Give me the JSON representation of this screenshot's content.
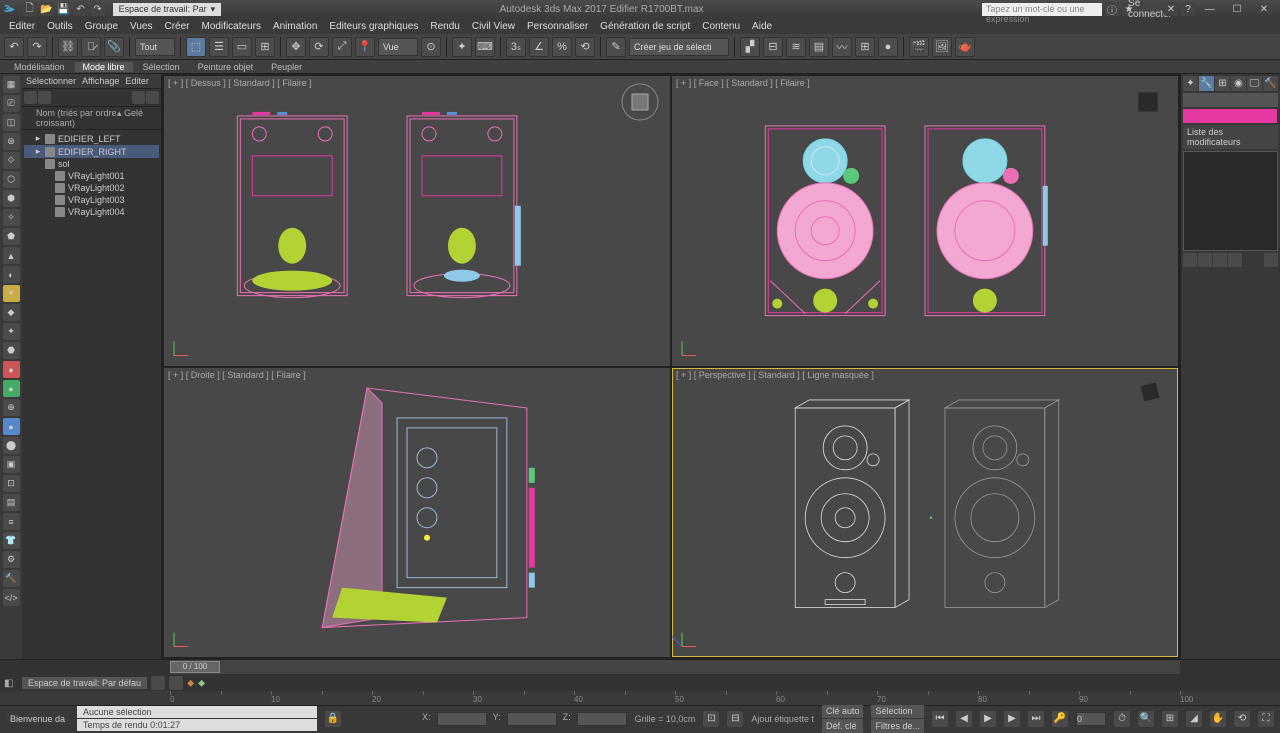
{
  "app": {
    "title": "Autodesk 3ds Max 2017    Edifier R1700BT.max",
    "workspace_tab": "Espace de travail: Par",
    "search_placeholder": "Tapez un mot-clé ou une expression",
    "signin": "Se connecter"
  },
  "menu": [
    "Editer",
    "Outils",
    "Groupe",
    "Vues",
    "Créer",
    "Modificateurs",
    "Animation",
    "Editeurs graphiques",
    "Rendu",
    "Civil View",
    "Personnaliser",
    "Génération de script",
    "Contenu",
    "Aide"
  ],
  "toolbar": {
    "dd_tout": "Tout",
    "dd_vue": "Vue",
    "create_sel": "Créer jeu de sélecti"
  },
  "ribbon": {
    "items": [
      "Modélisation",
      "Mode libre",
      "Sélection",
      "Peinture objet",
      "Peupler"
    ],
    "active": 1
  },
  "scene": {
    "tabs": [
      "Sélectionner",
      "Affichage",
      "Editer"
    ],
    "col1": "Nom (triés par ordre croissant)",
    "col2": "Gelé",
    "items": [
      {
        "exp": "▸",
        "name": "EDIFIER_LEFT",
        "sel": false,
        "indent": 1
      },
      {
        "exp": "▸",
        "name": "EDIFIER_RIGHT",
        "sel": true,
        "indent": 1
      },
      {
        "exp": "",
        "name": "sol",
        "sel": false,
        "indent": 1
      },
      {
        "exp": "",
        "name": "VRayLight001",
        "sel": false,
        "indent": 2
      },
      {
        "exp": "",
        "name": "VRayLight002",
        "sel": false,
        "indent": 2
      },
      {
        "exp": "",
        "name": "VRayLight003",
        "sel": false,
        "indent": 2
      },
      {
        "exp": "",
        "name": "VRayLight004",
        "sel": false,
        "indent": 2
      }
    ]
  },
  "viewports": {
    "tl": "[ + ] [ Dessus ] [ Standard ] [ Filaire ]",
    "tr": "[ + ] [ Face ] [ Standard ] [ Filaire ]",
    "bl": "[ + ] [ Droite ] [ Standard ] [ Filaire ]",
    "br": "[ + ] [ Perspective ] [ Standard ] [ Ligne masquée ]"
  },
  "modifier_panel": {
    "section": "Liste des modificateurs"
  },
  "timeline": {
    "frame": "0 / 100"
  },
  "workspace_bar": {
    "label": "Espace de travail: Par défau"
  },
  "status": {
    "welcome": "Bienvenue da",
    "selection": "Aucune sélection",
    "render_time_label": "Temps de rendu",
    "render_time": "0:01:27",
    "x_label": "X:",
    "y_label": "Y:",
    "z_label": "Z:",
    "grid_label": "Grille =",
    "grid_val": "10,0cm",
    "autokey": "Clé auto",
    "setkey": "Déf. clé",
    "selmode": "Sélection",
    "keyfilters": "Filtres de...",
    "addtime": "Ajout étiquette t"
  },
  "colors": {
    "pink": "#ec6fb5",
    "cyan": "#7ad0e0",
    "green": "#b3d334",
    "magenta": "#e538a0",
    "lblue": "#9bb8d8",
    "yellow": "#d4b83a"
  }
}
